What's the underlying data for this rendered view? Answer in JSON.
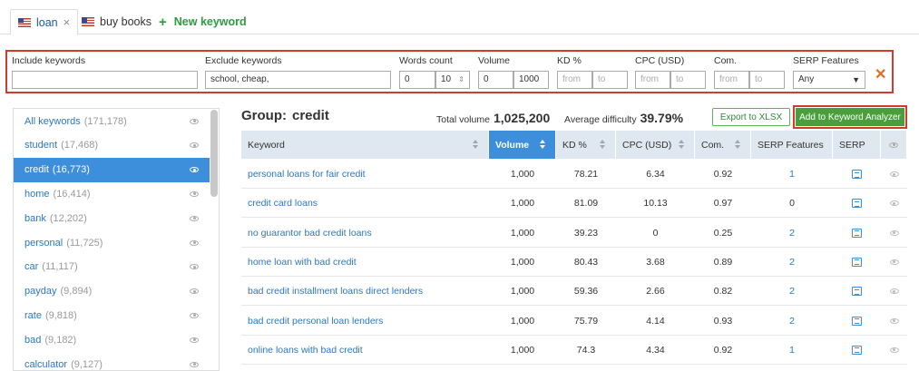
{
  "tabs": [
    {
      "label": "loan",
      "close": "×",
      "active": true
    },
    {
      "label": "buy books",
      "active": false
    }
  ],
  "new_keyword": {
    "plus": "+",
    "label": "New keyword"
  },
  "filters": {
    "include": {
      "label": "Include keywords",
      "value": ""
    },
    "exclude": {
      "label": "Exclude keywords",
      "value": "school, cheap,"
    },
    "words_count": {
      "label": "Words count",
      "from": "0",
      "to": "10"
    },
    "volume": {
      "label": "Volume",
      "from": "0",
      "to": "1000"
    },
    "kd": {
      "label": "KD %",
      "from_placeholder": "from",
      "to_placeholder": "to"
    },
    "cpc": {
      "label": "CPC (USD)",
      "from_placeholder": "from",
      "to_placeholder": "to"
    },
    "com": {
      "label": "Com.",
      "from_placeholder": "from",
      "to_placeholder": "to"
    },
    "serp_features": {
      "label": "SERP Features",
      "value": "Any"
    },
    "clear": "✕"
  },
  "sidebar": {
    "items": [
      {
        "name": "All keywords",
        "count": "(171,178)"
      },
      {
        "name": "student",
        "count": "(17,468)"
      },
      {
        "name": "credit",
        "count": "(16,773)",
        "active": true
      },
      {
        "name": "home",
        "count": "(16,414)"
      },
      {
        "name": "bank",
        "count": "(12,202)"
      },
      {
        "name": "personal",
        "count": "(11,725)"
      },
      {
        "name": "car",
        "count": "(11,117)"
      },
      {
        "name": "payday",
        "count": "(9,894)"
      },
      {
        "name": "rate",
        "count": "(9,818)"
      },
      {
        "name": "bad",
        "count": "(9,182)"
      },
      {
        "name": "calculator",
        "count": "(9,127)"
      }
    ]
  },
  "group": {
    "label": "Group:",
    "value": "credit"
  },
  "total_volume": {
    "label": "Total volume",
    "value": "1,025,200"
  },
  "avg_difficulty": {
    "label": "Average difficulty",
    "value": "39.79%"
  },
  "buttons": {
    "export": "Export to XLSX",
    "add": "Add to Keyword Analyzer"
  },
  "table": {
    "headers": [
      "Keyword",
      "Volume",
      "KD %",
      "CPC (USD)",
      "Com.",
      "SERP Features",
      "SERP"
    ],
    "rows": [
      {
        "keyword": "personal loans for fair credit",
        "volume": "1,000",
        "kd": "78.21",
        "cpc": "6.34",
        "com": "0.92",
        "serp": "1"
      },
      {
        "keyword": "credit card loans",
        "volume": "1,000",
        "kd": "81.09",
        "cpc": "10.13",
        "com": "0.97",
        "serp": "0"
      },
      {
        "keyword": "no guarantor bad credit loans",
        "volume": "1,000",
        "kd": "39.23",
        "cpc": "0",
        "com": "0.25",
        "serp": "2"
      },
      {
        "keyword": "home loan with bad credit",
        "volume": "1,000",
        "kd": "80.43",
        "cpc": "3.68",
        "com": "0.89",
        "serp": "2"
      },
      {
        "keyword": "bad credit installment loans direct lenders",
        "volume": "1,000",
        "kd": "59.36",
        "cpc": "2.66",
        "com": "0.82",
        "serp": "2"
      },
      {
        "keyword": "bad credit personal loan lenders",
        "volume": "1,000",
        "kd": "75.79",
        "cpc": "4.14",
        "com": "0.93",
        "serp": "2"
      },
      {
        "keyword": "online loans with bad credit",
        "volume": "1,000",
        "kd": "74.3",
        "cpc": "4.34",
        "com": "0.92",
        "serp": "1"
      }
    ]
  },
  "colors": {
    "accent": "#3d8edb",
    "highlight_border": "#d03a2f",
    "primary_button": "#4a9e3c",
    "link": "#2a78c2"
  },
  "icons": {
    "flag": "us-flag-icon",
    "eye": "eye-icon",
    "serp": "serp-document-icon",
    "sort": "sort-icon"
  }
}
